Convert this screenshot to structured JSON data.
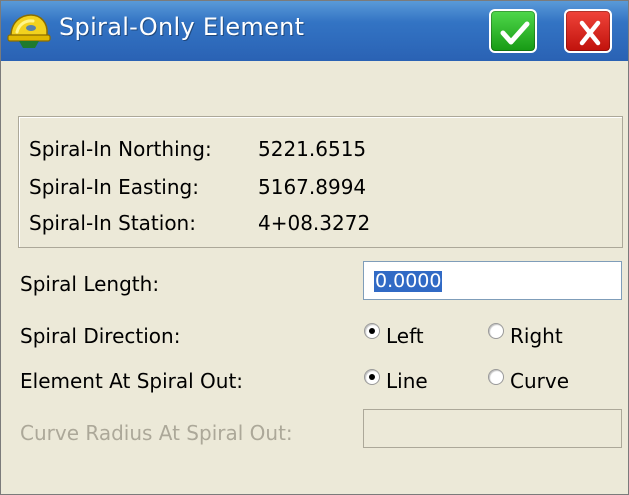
{
  "window": {
    "title": "Spiral-Only Element",
    "ok_icon": "check-icon",
    "close_icon": "close-icon",
    "accent_color": "#2a62b4",
    "ok_color": "#179a14",
    "close_color": "#c0120c"
  },
  "spiral_in": {
    "northing_label": "Spiral-In Northing:",
    "northing_value": "5221.6515",
    "easting_label": "Spiral-In Easting:",
    "easting_value": "5167.8994",
    "station_label": "Spiral-In Station:",
    "station_value": "4+08.3272"
  },
  "form": {
    "spiral_length_label": "Spiral Length:",
    "spiral_length_value": "0.0000",
    "spiral_direction_label": "Spiral Direction:",
    "direction_options": [
      "Left",
      "Right"
    ],
    "direction_selected": "Left",
    "element_out_label": "Element At Spiral Out:",
    "element_out_options": [
      "Line",
      "Curve"
    ],
    "element_out_selected": "Line",
    "curve_radius_label": "Curve Radius At Spiral Out:",
    "curve_radius_value": ""
  }
}
